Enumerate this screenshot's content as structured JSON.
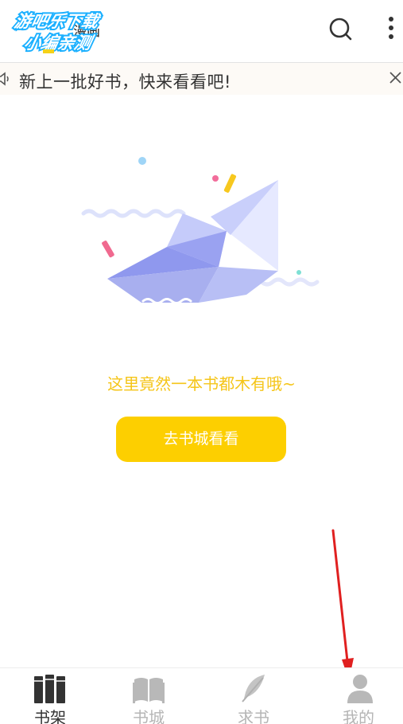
{
  "header": {
    "title": "漫画",
    "watermark_line1": "游吧乐下载",
    "watermark_line2": "小编亲测"
  },
  "notice": {
    "text": "新上一批好书，快来看看吧!"
  },
  "empty_state": {
    "message": "这里竟然一本书都木有哦~",
    "button_label": "去书城看看"
  },
  "tabs": [
    {
      "label": "书架",
      "icon": "bookshelf-icon",
      "active": true
    },
    {
      "label": "书城",
      "icon": "open-book-icon",
      "active": false
    },
    {
      "label": "求书",
      "icon": "feather-icon",
      "active": false
    },
    {
      "label": "我的",
      "icon": "user-icon",
      "active": false
    }
  ],
  "colors": {
    "accent": "#fdcf00",
    "empty_text": "#f5c518",
    "tab_active": "#333333",
    "tab_inactive": "#b5b5b5",
    "annotation_arrow": "#e02020"
  }
}
